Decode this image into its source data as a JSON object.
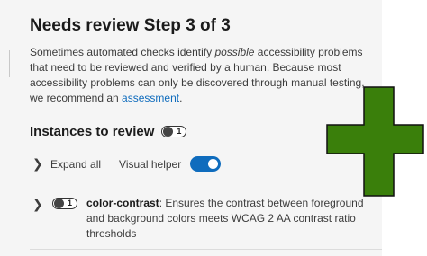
{
  "page": {
    "title": "Needs review Step 3 of 3",
    "description": {
      "part1": "Sometimes automated checks identify ",
      "italic": "possible",
      "part2": " accessibility problems that need to be reviewed and verified by a human. Because most accessibility problems can only be discovered through manual testing, we recommend an ",
      "link": "assessment",
      "part3": "."
    }
  },
  "instances": {
    "title": "Instances to review",
    "count": "1"
  },
  "controls": {
    "expand_all": "Expand all",
    "visual_helper": "Visual helper",
    "visual_helper_on": true
  },
  "rules": [
    {
      "count": "1",
      "id": "color-contrast",
      "description": ": Ensures the contrast between foreground and background colors meets WCAG 2 AA contrast ratio thresholds"
    }
  ],
  "icons": {
    "chevron": "chevron-right-icon",
    "overlay": "green-plus-cross-icon"
  },
  "colors": {
    "accent": "#0f6cbd",
    "cross_fill": "#3a7f0b",
    "panel_bg": "#f5f5f5"
  }
}
